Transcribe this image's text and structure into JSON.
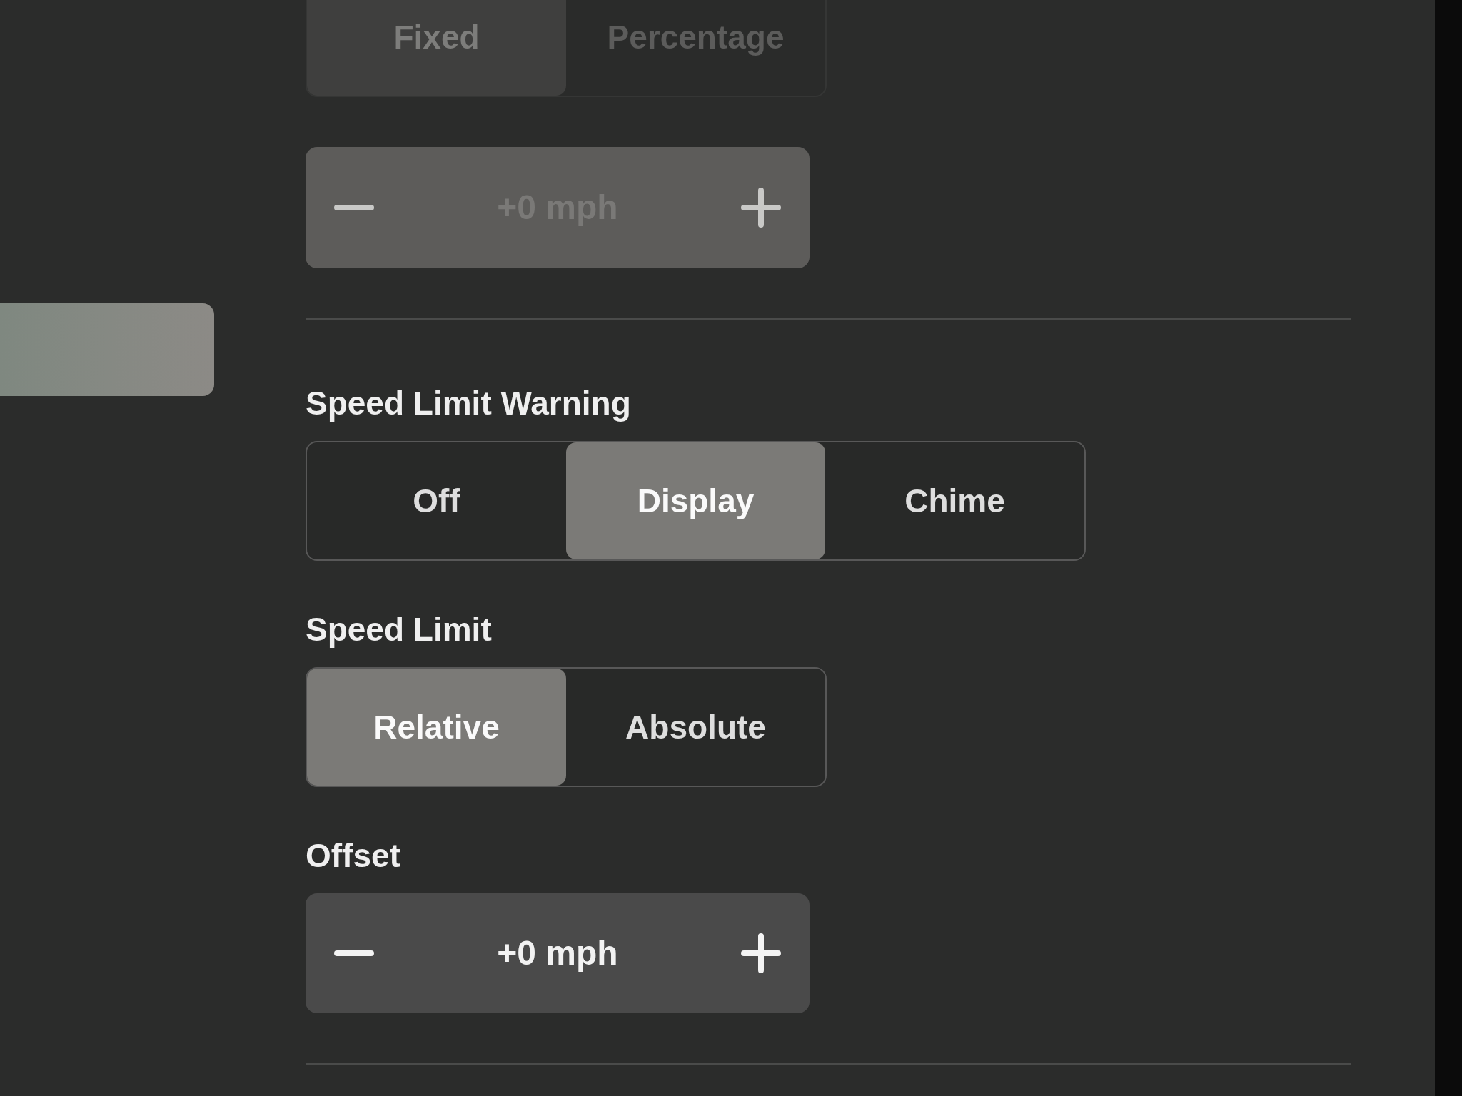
{
  "sidebar": {
    "items": [
      {
        "selected": true
      }
    ]
  },
  "groups": [
    {
      "kind": "segmented",
      "disabled": true,
      "options": [
        {
          "label": "Fixed",
          "selected": true
        },
        {
          "label": "Percentage",
          "selected": false
        }
      ]
    },
    {
      "kind": "stepper",
      "disabled": true,
      "value": "+0 mph"
    },
    {
      "kind": "divider"
    },
    {
      "kind": "segmented",
      "title": "Speed Limit Warning",
      "disabled": false,
      "options": [
        {
          "label": "Off",
          "selected": false
        },
        {
          "label": "Display",
          "selected": true
        },
        {
          "label": "Chime",
          "selected": false
        }
      ]
    },
    {
      "kind": "segmented",
      "title": "Speed Limit",
      "disabled": false,
      "options": [
        {
          "label": "Relative",
          "selected": true
        },
        {
          "label": "Absolute",
          "selected": false
        }
      ]
    },
    {
      "kind": "stepper",
      "title": "Offset",
      "disabled": false,
      "value": "+0 mph"
    },
    {
      "kind": "divider"
    }
  ]
}
